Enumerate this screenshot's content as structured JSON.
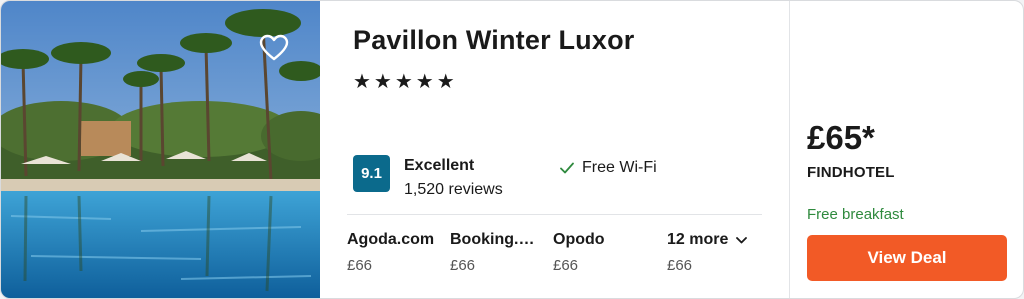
{
  "hotel": {
    "name": "Pavillon Winter Luxor",
    "stars_text": "★★★★★",
    "rating": {
      "score": "9.1",
      "label": "Excellent",
      "reviews": "1,520 reviews"
    },
    "amenity": "Free Wi-Fi"
  },
  "providers": [
    {
      "name": "Agoda.com",
      "price": "£66"
    },
    {
      "name": "Booking.…",
      "price": "£66"
    },
    {
      "name": "Opodo",
      "price": "£66"
    },
    {
      "name": "12 more",
      "price": "£66"
    }
  ],
  "offer": {
    "price": "£65*",
    "provider": "FINDHOTEL",
    "perk": "Free breakfast",
    "button_label": "View Deal"
  },
  "icons": {
    "favorite": "heart-icon",
    "amenity": "check-icon",
    "more": "chevron-down-icon"
  },
  "colors": {
    "rating_badge": "#0b6a8c",
    "deal_button": "#f25a26",
    "perk_text": "#2f8a3e"
  }
}
